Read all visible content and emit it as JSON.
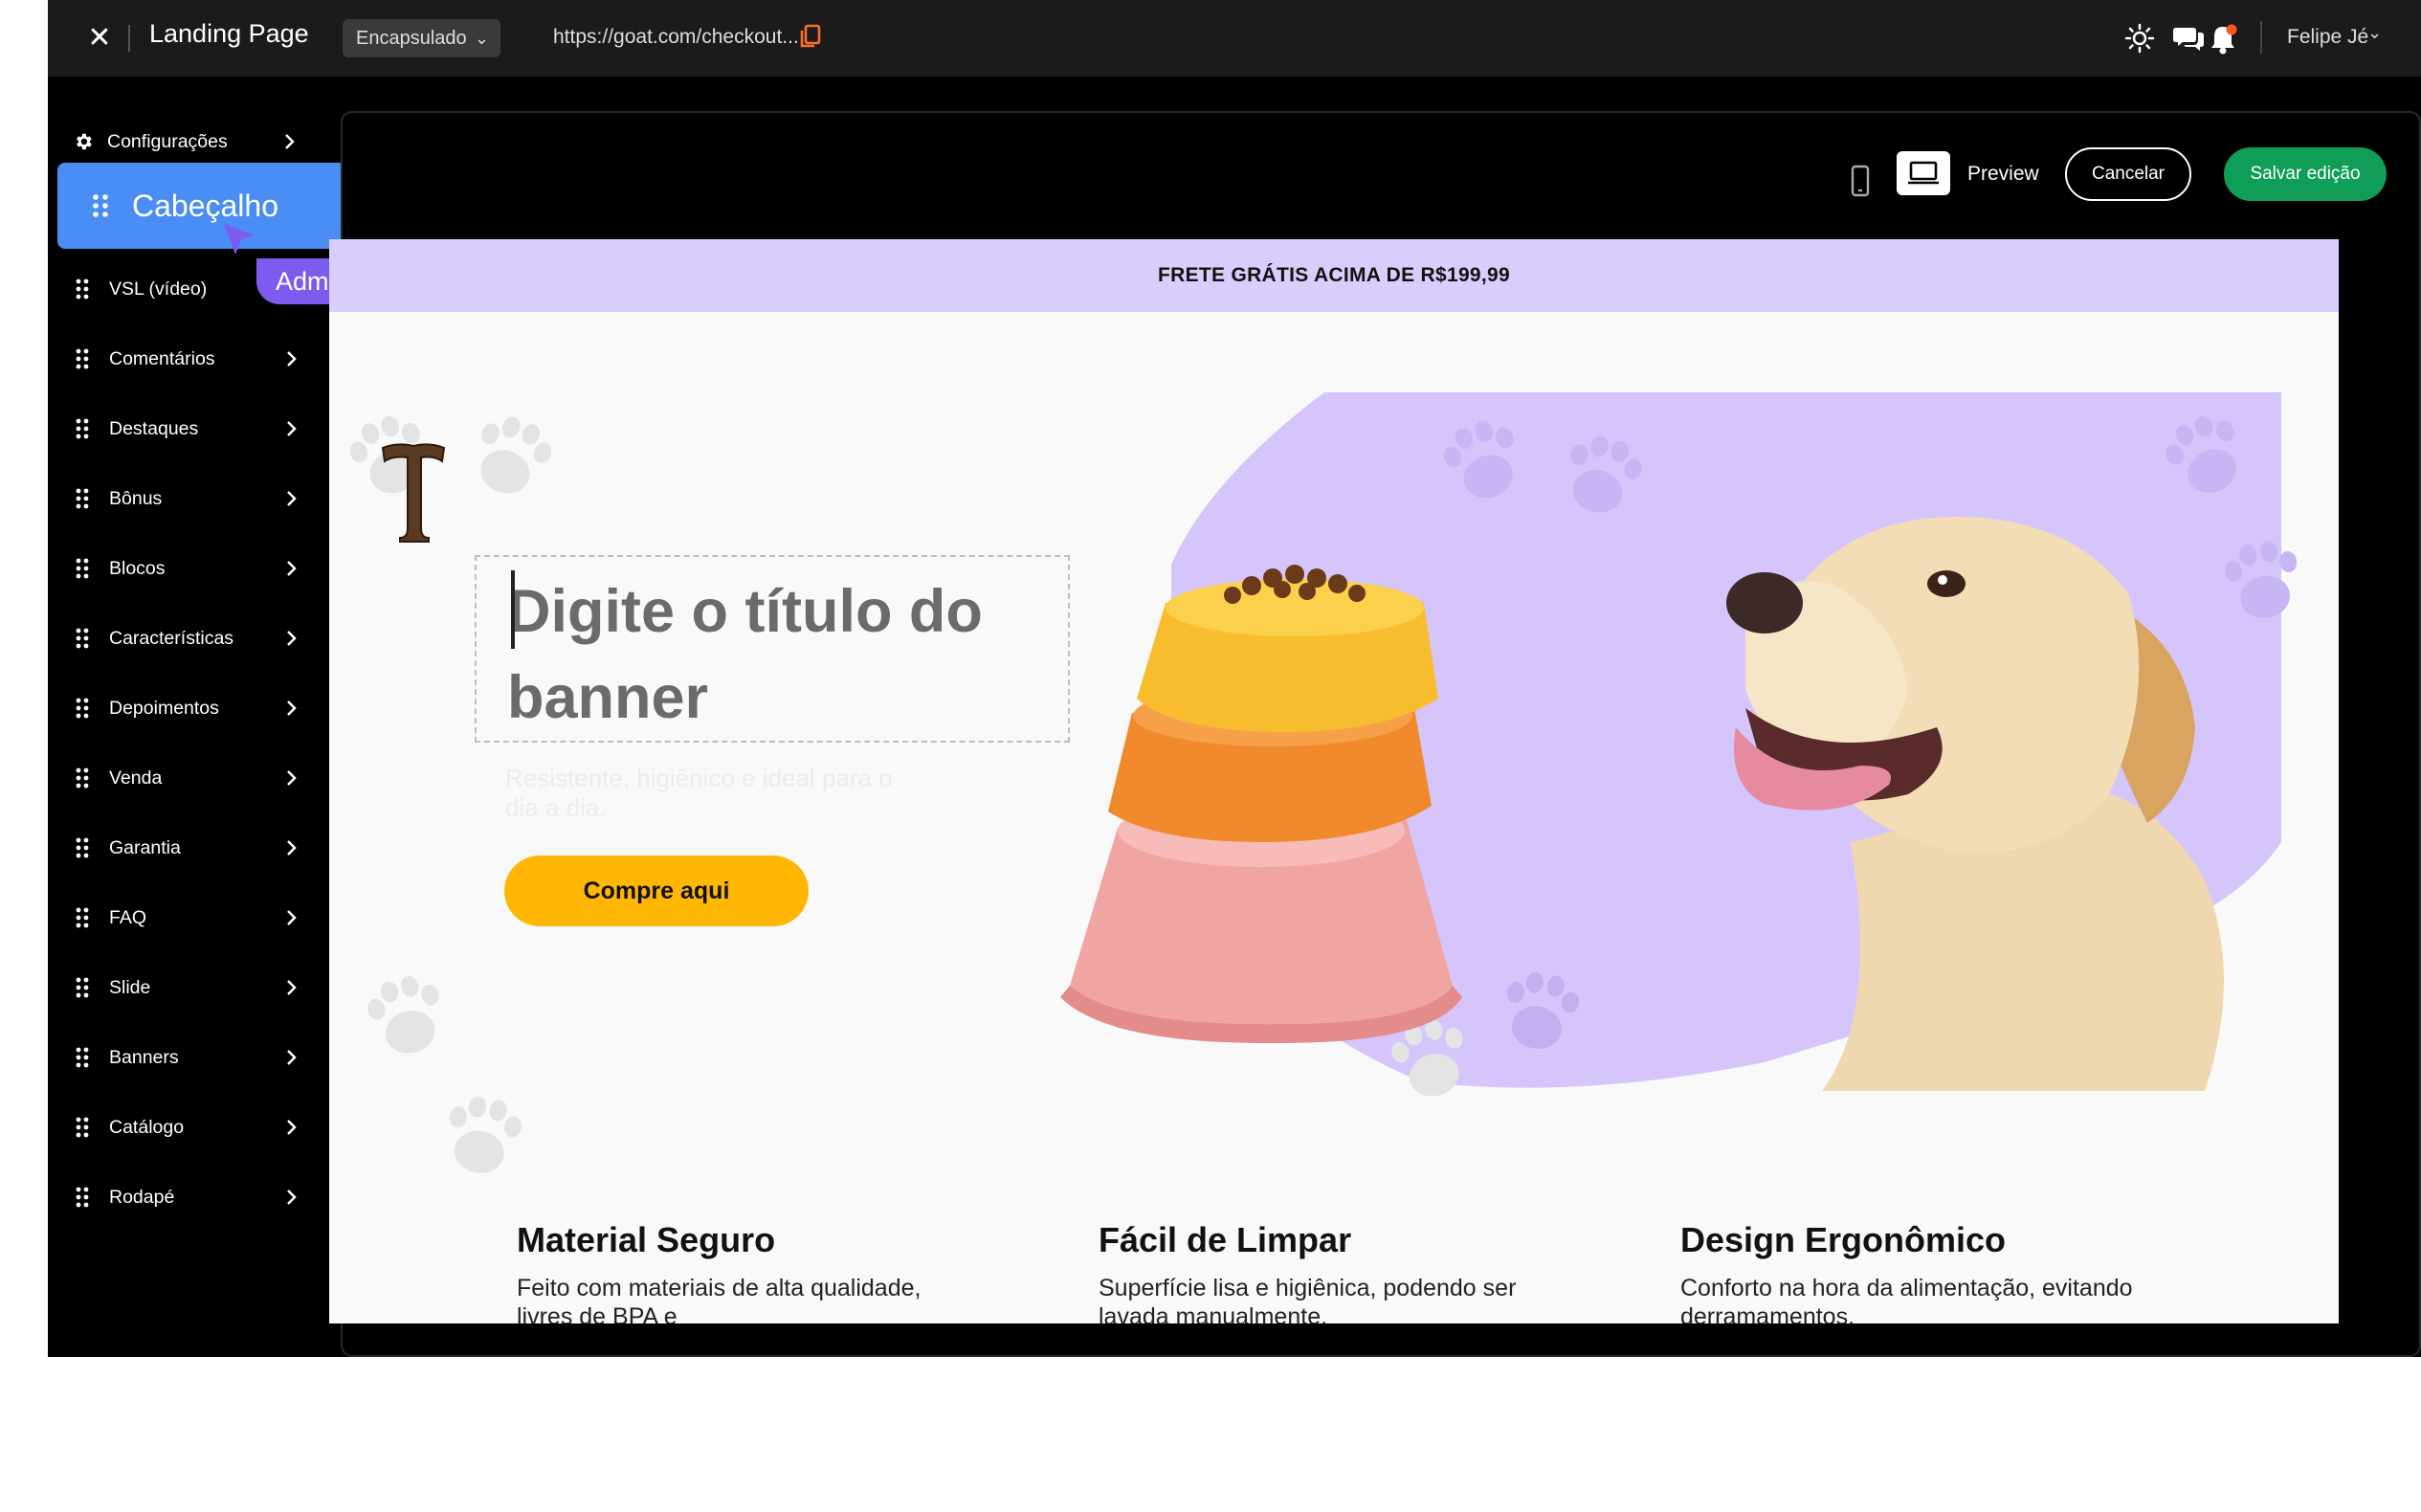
{
  "topbar": {
    "title": "Landing Page",
    "layout_select": "Encapsulado",
    "url": "https://goat.com/checkout...",
    "user_name": "Felipe Jé"
  },
  "sidebar": {
    "settings_label": "Configurações",
    "dragging_label": "Cabeçalho",
    "admin_tag": "Administrador",
    "items": [
      {
        "label": "VSL (vídeo)"
      },
      {
        "label": "Comentários"
      },
      {
        "label": "Destaques"
      },
      {
        "label": "Bônus"
      },
      {
        "label": "Blocos"
      },
      {
        "label": "Características"
      },
      {
        "label": "Depoimentos"
      },
      {
        "label": "Venda"
      },
      {
        "label": "Garantia"
      },
      {
        "label": "FAQ"
      },
      {
        "label": "Slide"
      },
      {
        "label": "Banners"
      },
      {
        "label": "Catálogo"
      },
      {
        "label": "Rodapé"
      }
    ]
  },
  "editor": {
    "preview_label": "Preview",
    "cancel_label": "Cancelar",
    "save_label": "Salvar edição"
  },
  "landing": {
    "promo_text": "FRETE GRÁTIS ACIMA DE R$199,99",
    "banner_title": "Digite o título do banner",
    "banner_subtitle": "Resistente, higiênico e ideal para o dia a dia.",
    "cta_label": "Compre aqui",
    "features": [
      {
        "title": "Material Seguro",
        "text": "Feito com materiais de alta qualidade, livres de BPA e"
      },
      {
        "title": "Fácil de Limpar",
        "text": "Superfície lisa e higiênica, podendo ser lavada manualmente."
      },
      {
        "title": "Design Ergonômico",
        "text": "Conforto na hora da alimentação, evitando derramamentos."
      }
    ]
  },
  "colors": {
    "accent_blue": "#4a8df4",
    "admin_purple": "#7e5bef",
    "save_green": "#0f9d58",
    "promo_lilac": "#d9cdfb",
    "cta_yellow": "#ffb703",
    "notification_dot": "#ff5722"
  }
}
